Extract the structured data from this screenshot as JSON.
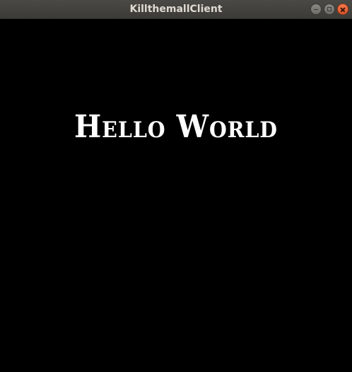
{
  "window": {
    "title": "KillthemallClient"
  },
  "controls": {
    "minimize_icon": "minimize-icon",
    "maximize_icon": "maximize-icon",
    "close_icon": "close-icon",
    "close_color": "#e95420"
  },
  "content": {
    "text": "Hello World",
    "background": "#000000",
    "text_color": "#ffffff"
  }
}
